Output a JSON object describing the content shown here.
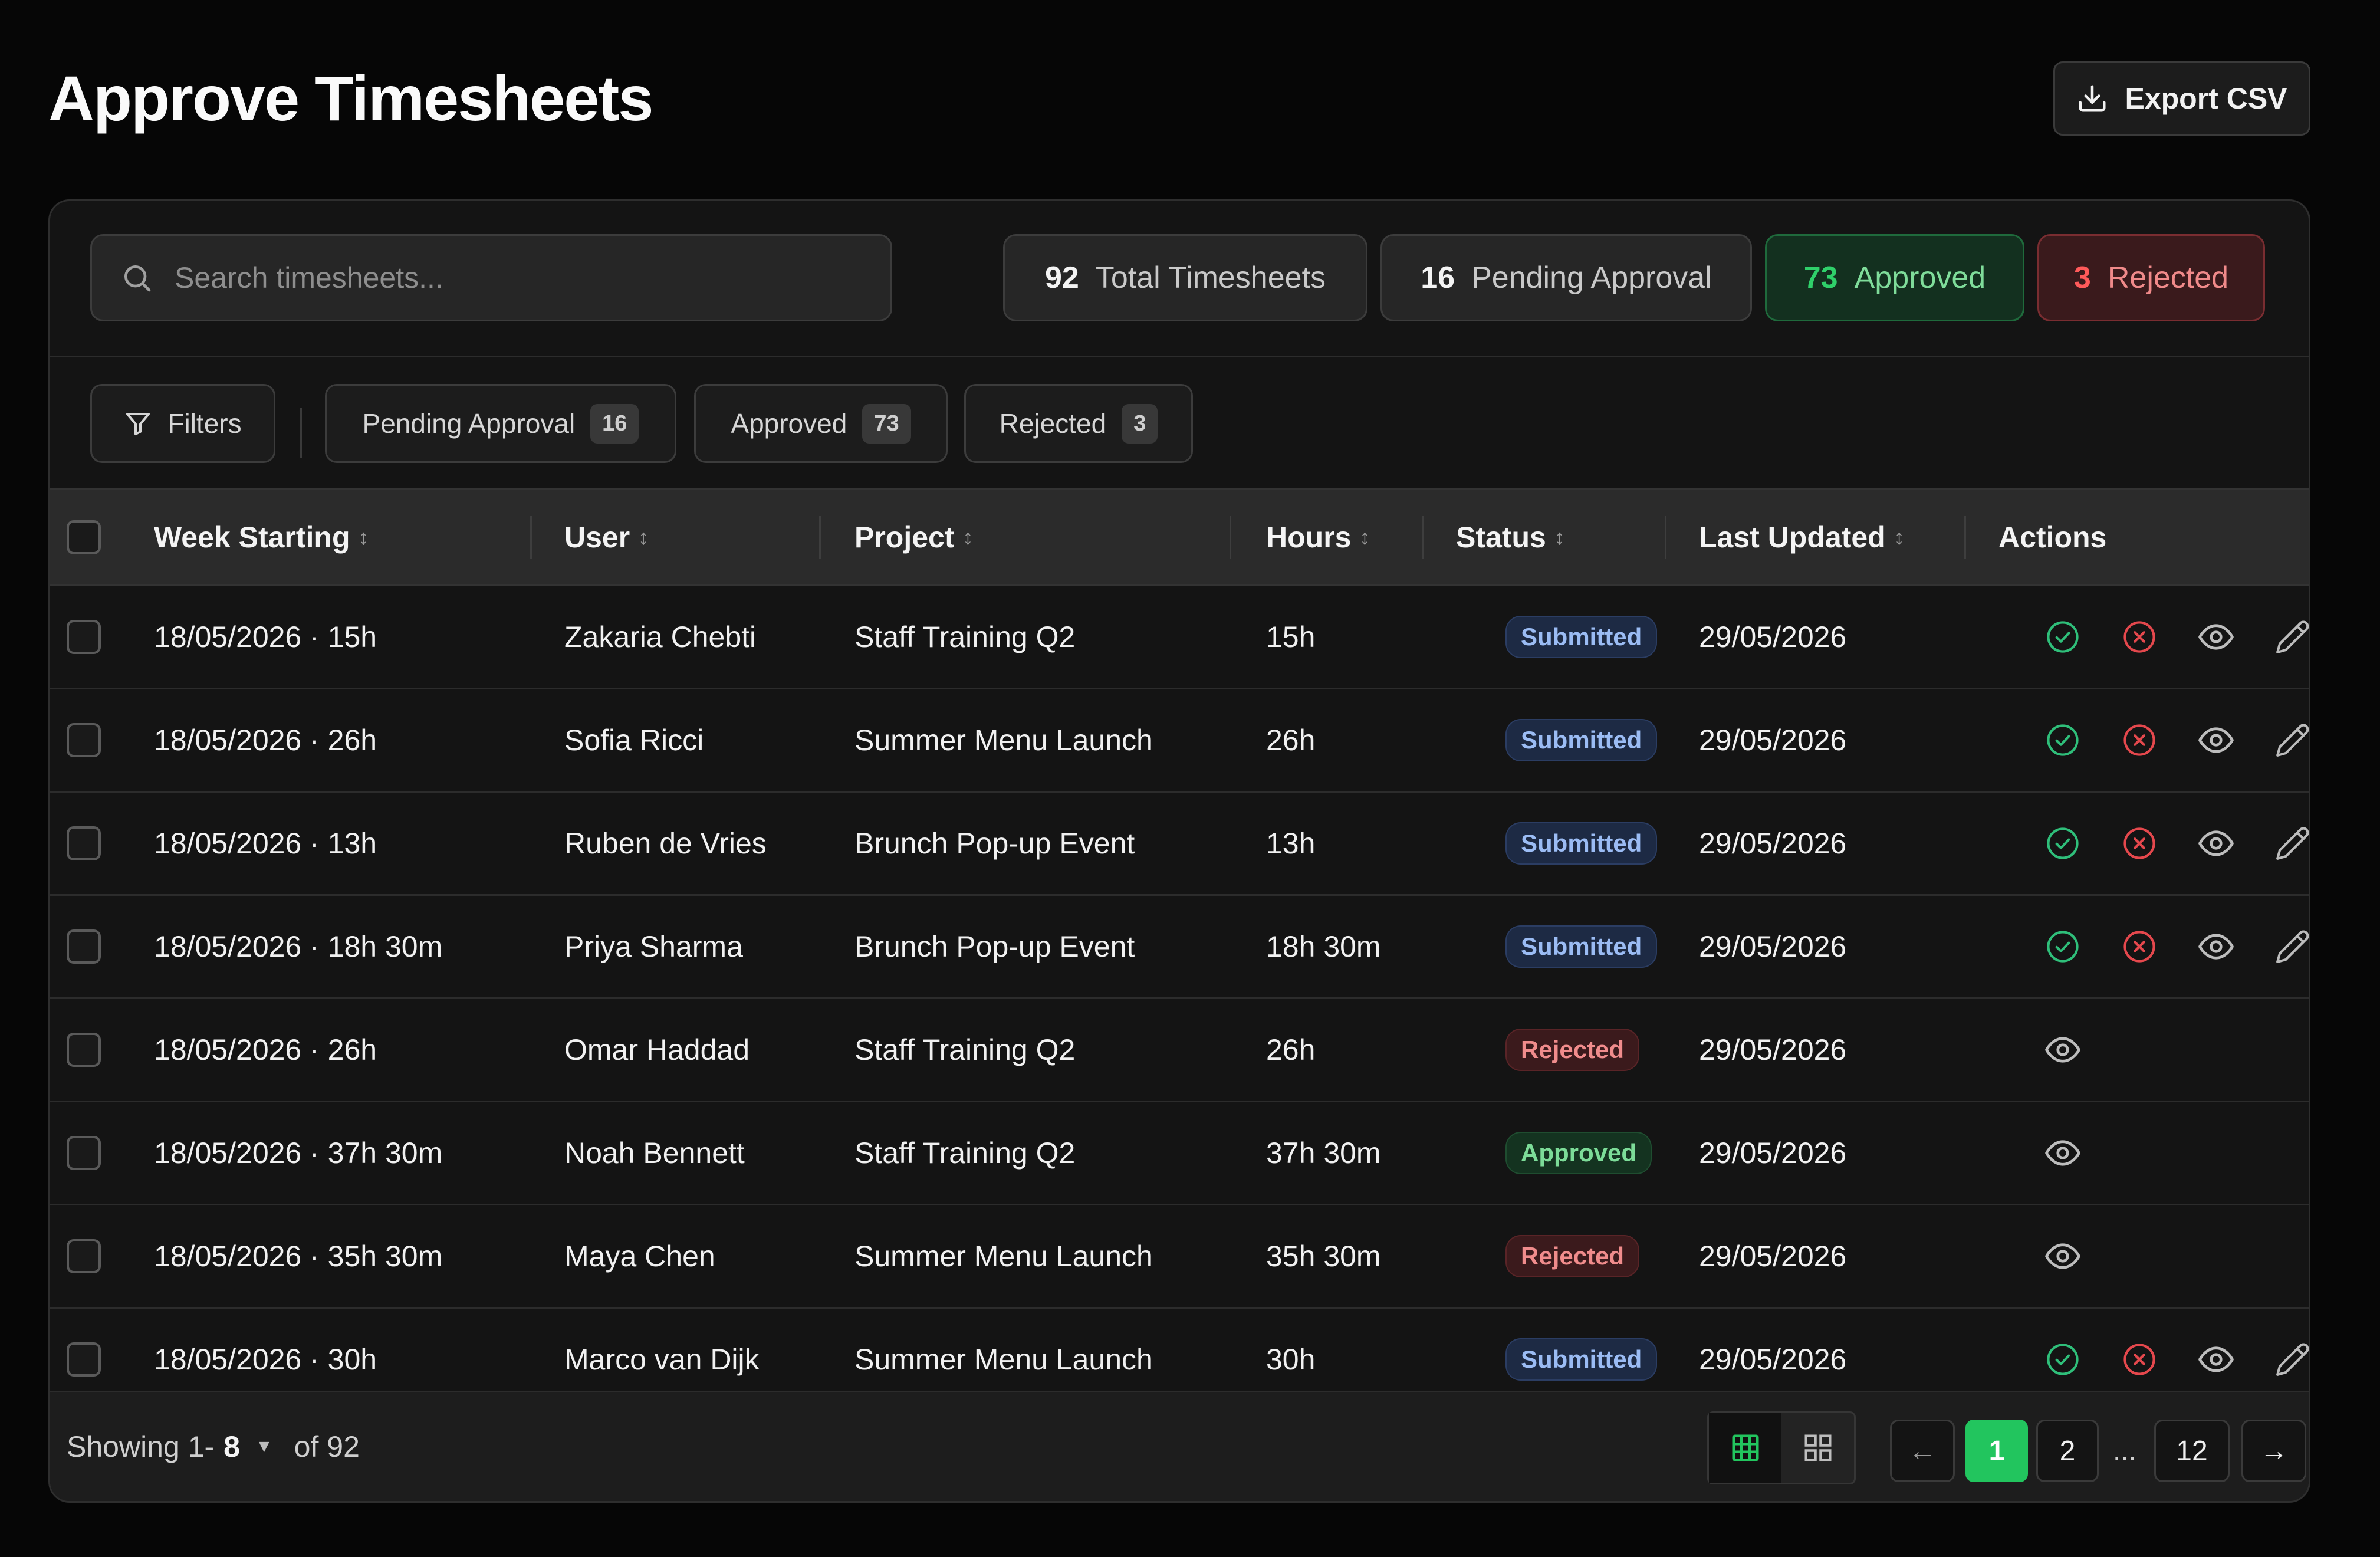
{
  "header": {
    "title": "Approve Timesheets",
    "export_label": "Export CSV"
  },
  "search": {
    "placeholder": "Search timesheets..."
  },
  "stats": {
    "total": {
      "count": "92",
      "label": "Total Timesheets"
    },
    "pending": {
      "count": "16",
      "label": "Pending Approval"
    },
    "approved": {
      "count": "73",
      "label": "Approved",
      "color": "#22c55e"
    },
    "rejected": {
      "count": "3",
      "label": "Rejected",
      "color": "#ef4444"
    }
  },
  "filters": {
    "button_label": "Filters",
    "chips": [
      {
        "label": "Pending Approval",
        "count": "16"
      },
      {
        "label": "Approved",
        "count": "73"
      },
      {
        "label": "Rejected",
        "count": "3"
      }
    ]
  },
  "table": {
    "columns": [
      "Week Starting",
      "User",
      "Project",
      "Hours",
      "Status",
      "Last Updated",
      "Actions"
    ],
    "sort_glyph": "↕",
    "rows": [
      {
        "week": "18/05/2026 · 15h",
        "user": "Zakaria Chebti",
        "project": "Staff Training Q2",
        "hours": "15h",
        "status": "Submitted",
        "updated": "29/05/2026"
      },
      {
        "week": "18/05/2026 · 26h",
        "user": "Sofia Ricci",
        "project": "Summer Menu Launch",
        "hours": "26h",
        "status": "Submitted",
        "updated": "29/05/2026"
      },
      {
        "week": "18/05/2026 · 13h",
        "user": "Ruben de Vries",
        "project": "Brunch Pop-up Event",
        "hours": "13h",
        "status": "Submitted",
        "updated": "29/05/2026"
      },
      {
        "week": "18/05/2026 · 18h 30m",
        "user": "Priya Sharma",
        "project": "Brunch Pop-up Event",
        "hours": "18h 30m",
        "status": "Submitted",
        "updated": "29/05/2026"
      },
      {
        "week": "18/05/2026 · 26h",
        "user": "Omar Haddad",
        "project": "Staff Training Q2",
        "hours": "26h",
        "status": "Rejected",
        "updated": "29/05/2026"
      },
      {
        "week": "18/05/2026 · 37h 30m",
        "user": "Noah Bennett",
        "project": "Staff Training Q2",
        "hours": "37h 30m",
        "status": "Approved",
        "updated": "29/05/2026"
      },
      {
        "week": "18/05/2026 · 35h 30m",
        "user": "Maya Chen",
        "project": "Summer Menu Launch",
        "hours": "35h 30m",
        "status": "Rejected",
        "updated": "29/05/2026"
      },
      {
        "week": "18/05/2026 · 30h",
        "user": "Marco van Dijk",
        "project": "Summer Menu Launch",
        "hours": "30h",
        "status": "Submitted",
        "updated": "29/05/2026"
      }
    ]
  },
  "footer": {
    "showing_prefix": "Showing 1-",
    "per_page": "8",
    "of_total": "of 92",
    "pages": [
      "1",
      "2",
      "...",
      "12"
    ],
    "current_page": "1",
    "prev_glyph": "←",
    "next_glyph": "→"
  },
  "icons": {
    "approve": "check-circle-icon",
    "reject": "x-circle-icon",
    "view": "eye-icon",
    "edit": "pencil-icon"
  },
  "colors": {
    "accent": "#22c55e",
    "approve": "#2fbf7a",
    "reject": "#e5484d",
    "submitted_badge": "#9bbcf4",
    "rejected_badge": "#f08c8c",
    "approved_badge": "#7cdc98"
  }
}
